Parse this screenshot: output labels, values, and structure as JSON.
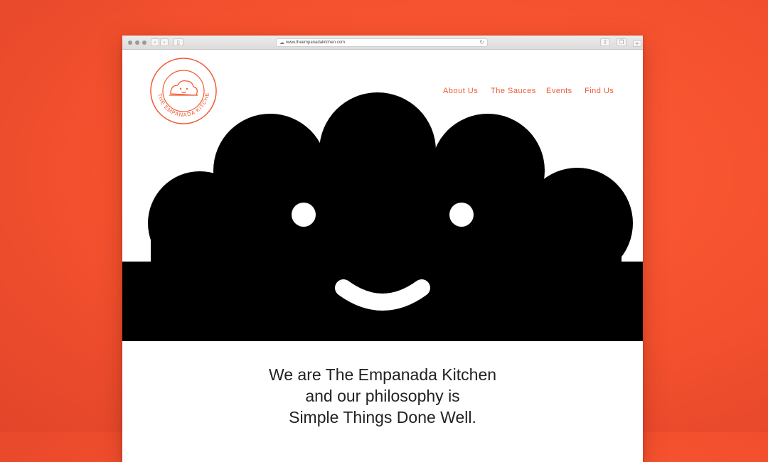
{
  "browser": {
    "url": "www.theempanadakitchen.com",
    "back_icon": "chevron-left-icon",
    "forward_icon": "chevron-right-icon",
    "sidebar_icon": "sidebar-icon",
    "share_icon": "share-icon",
    "tabs_icon": "tabs-icon",
    "reload_icon": "reload-icon"
  },
  "site": {
    "logo_text": "THE EMPANADA KITCHEN",
    "nav": {
      "about": "About Us",
      "sauces": "The Sauces",
      "events": "Events",
      "find": "Find Us"
    },
    "headline": {
      "line1": "We are The Empanada Kitchen",
      "line2": "and our philosophy is",
      "line3": "Simple Things Done Well."
    }
  },
  "colors": {
    "background": "#f4512e",
    "accent": "#f05a34",
    "mascot": "#000000"
  }
}
